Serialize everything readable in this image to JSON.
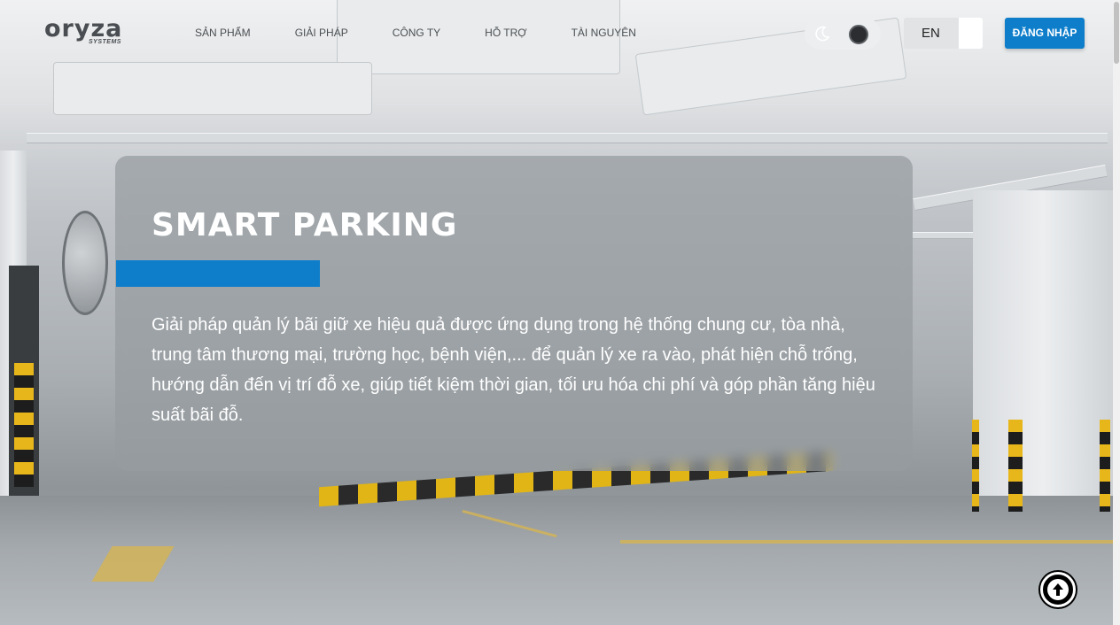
{
  "header": {
    "logo_text": "oryza",
    "logo_subtext": "SYSTEMS",
    "nav": [
      {
        "label": "SẢN PHẨM"
      },
      {
        "label": "GIẢI PHÁP"
      },
      {
        "label": "CÔNG TY"
      },
      {
        "label": "HỖ TRỢ"
      },
      {
        "label": "TÀI NGUYÊN"
      }
    ],
    "language": "EN",
    "login_label": "ĐĂNG NHẬP"
  },
  "hero": {
    "title": "SMART PARKING",
    "description": "Giải pháp quản lý bãi giữ xe hiệu quả được ứng dụng trong hệ thống chung cư, tòa nhà, trung tâm thương mại, trường học, bệnh viện,... để quản lý xe ra vào, phát hiện chỗ trống, hướng dẫn đến vị trí đỗ xe, giúp tiết kiệm thời gian, tối ưu hóa chi phí và góp phần tăng hiệu suất bãi đỗ."
  },
  "colors": {
    "accent": "#0e7ecb",
    "card_bg": "#969ba0",
    "text_light": "#ffffff"
  },
  "icons": {
    "theme_light": "moon-icon",
    "theme_dark": "dark-mode-dot-icon",
    "back_to_top": "arrow-up-circle-icon"
  }
}
